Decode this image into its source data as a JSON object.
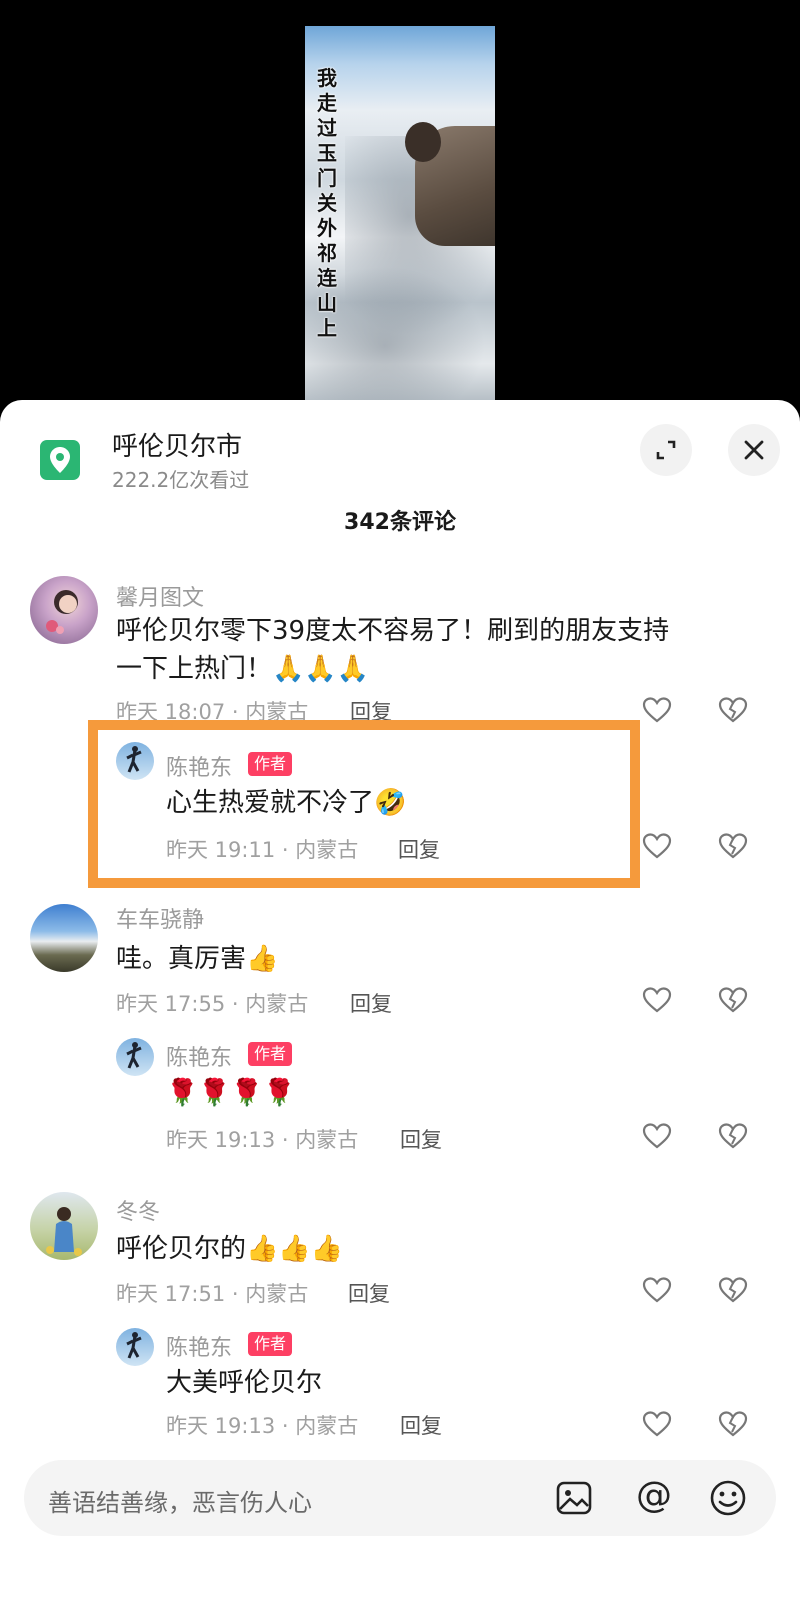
{
  "video": {
    "caption": "我走过玉门关外祁连山上"
  },
  "header": {
    "location_title": "呼伦贝尔市",
    "views": "222.2亿次看过",
    "comment_count": "342条评论"
  },
  "comments": [
    {
      "user": "馨月图文",
      "text_line1": "呼伦贝尔零下39度太不容易了！刷到的朋友支持",
      "text_line2": "一下上热门！🙏🙏🙏",
      "meta": "昨天 18:07 · 内蒙古",
      "reply": "回复",
      "reply_item": {
        "user": "陈艳东",
        "badge": "作者",
        "text": "心生热爱就不冷了🤣",
        "meta": "昨天 19:11 · 内蒙古",
        "reply": "回复"
      }
    },
    {
      "user": "车车骁静",
      "text": "哇。真厉害👍",
      "meta": "昨天 17:55 · 内蒙古",
      "reply": "回复",
      "reply_item": {
        "user": "陈艳东",
        "badge": "作者",
        "text": "🌹🌹🌹🌹",
        "meta": "昨天 19:13 · 内蒙古",
        "reply": "回复"
      }
    },
    {
      "user": "冬冬",
      "text": "呼伦贝尔的👍👍👍",
      "meta": "昨天 17:51 · 内蒙古",
      "reply": "回复",
      "reply_item": {
        "user": "陈艳东",
        "badge": "作者",
        "text": "大美呼伦贝尔",
        "meta": "昨天 19:13 · 内蒙古",
        "reply": "回复"
      }
    }
  ],
  "input": {
    "placeholder": "善语结善缘，恶言伤人心"
  },
  "colors": {
    "accent_badge": "#fd3f63",
    "highlight": "#f59a3c",
    "location_icon": "#2bb673"
  }
}
